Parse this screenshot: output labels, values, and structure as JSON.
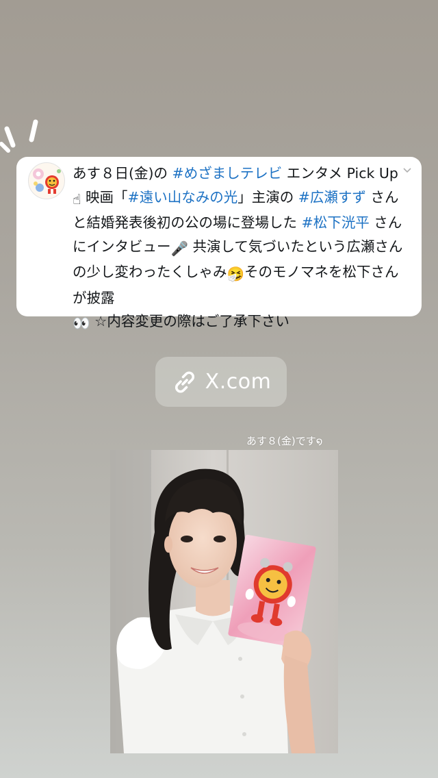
{
  "post": {
    "avatar_icon": "mezamashi-mascot-avatar",
    "menu_icon": "chevron-down-icon",
    "segments": [
      {
        "text": "あす８日(金)の ",
        "hashtag": false
      },
      {
        "text": "#めざましテレビ",
        "hashtag": true
      },
      {
        "text": " エンタメ Pick Up",
        "hashtag": false
      },
      {
        "text": "☝",
        "hashtag": false,
        "emoji": true
      },
      {
        "text": " 映画「",
        "hashtag": false
      },
      {
        "text": "#遠い山なみの光",
        "hashtag": true
      },
      {
        "text": "」主演の ",
        "hashtag": false
      },
      {
        "text": "#広瀬すず",
        "hashtag": true
      },
      {
        "text": " さんと結婚発表後初の公の場に登場した ",
        "hashtag": false
      },
      {
        "text": "#松下洸平",
        "hashtag": true
      },
      {
        "text": " さんにインタビュー",
        "hashtag": false
      },
      {
        "text": "🎤",
        "hashtag": false,
        "emoji": true
      },
      {
        "text": " 共演して気づいたという広瀬さんの少し変わったくしゃみ",
        "hashtag": false
      },
      {
        "text": "🤧",
        "hashtag": false,
        "emoji": true
      },
      {
        "text": "そのモノマネを松下さんが披露",
        "hashtag": false
      },
      {
        "text": "👀",
        "hashtag": false,
        "emoji": true
      },
      {
        "text": " ☆内容変更の際はご了承下さい",
        "hashtag": false
      }
    ],
    "colors": {
      "text": "#14171a",
      "hashtag": "#1d72c4"
    }
  },
  "link_sticker": {
    "icon": "link-icon",
    "label": "X.com"
  },
  "photo": {
    "caption": "あす８(金)です໑",
    "subject": "woman-in-white-blouse-holding-mascot-card"
  }
}
